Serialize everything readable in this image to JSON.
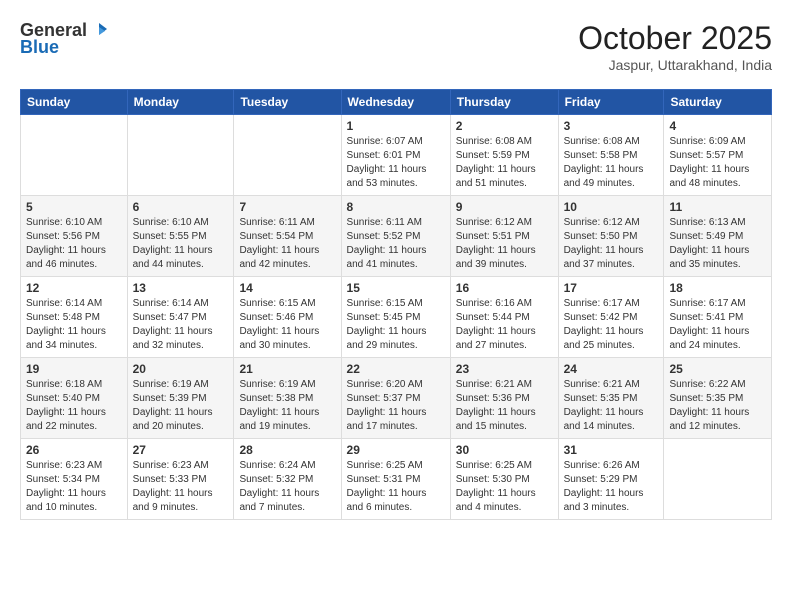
{
  "header": {
    "logo_general": "General",
    "logo_blue": "Blue",
    "month_title": "October 2025",
    "location": "Jaspur, Uttarakhand, India"
  },
  "days_of_week": [
    "Sunday",
    "Monday",
    "Tuesday",
    "Wednesday",
    "Thursday",
    "Friday",
    "Saturday"
  ],
  "weeks": [
    [
      {
        "day": "",
        "info": ""
      },
      {
        "day": "",
        "info": ""
      },
      {
        "day": "",
        "info": ""
      },
      {
        "day": "1",
        "info": "Sunrise: 6:07 AM\nSunset: 6:01 PM\nDaylight: 11 hours and 53 minutes."
      },
      {
        "day": "2",
        "info": "Sunrise: 6:08 AM\nSunset: 5:59 PM\nDaylight: 11 hours and 51 minutes."
      },
      {
        "day": "3",
        "info": "Sunrise: 6:08 AM\nSunset: 5:58 PM\nDaylight: 11 hours and 49 minutes."
      },
      {
        "day": "4",
        "info": "Sunrise: 6:09 AM\nSunset: 5:57 PM\nDaylight: 11 hours and 48 minutes."
      }
    ],
    [
      {
        "day": "5",
        "info": "Sunrise: 6:10 AM\nSunset: 5:56 PM\nDaylight: 11 hours and 46 minutes."
      },
      {
        "day": "6",
        "info": "Sunrise: 6:10 AM\nSunset: 5:55 PM\nDaylight: 11 hours and 44 minutes."
      },
      {
        "day": "7",
        "info": "Sunrise: 6:11 AM\nSunset: 5:54 PM\nDaylight: 11 hours and 42 minutes."
      },
      {
        "day": "8",
        "info": "Sunrise: 6:11 AM\nSunset: 5:52 PM\nDaylight: 11 hours and 41 minutes."
      },
      {
        "day": "9",
        "info": "Sunrise: 6:12 AM\nSunset: 5:51 PM\nDaylight: 11 hours and 39 minutes."
      },
      {
        "day": "10",
        "info": "Sunrise: 6:12 AM\nSunset: 5:50 PM\nDaylight: 11 hours and 37 minutes."
      },
      {
        "day": "11",
        "info": "Sunrise: 6:13 AM\nSunset: 5:49 PM\nDaylight: 11 hours and 35 minutes."
      }
    ],
    [
      {
        "day": "12",
        "info": "Sunrise: 6:14 AM\nSunset: 5:48 PM\nDaylight: 11 hours and 34 minutes."
      },
      {
        "day": "13",
        "info": "Sunrise: 6:14 AM\nSunset: 5:47 PM\nDaylight: 11 hours and 32 minutes."
      },
      {
        "day": "14",
        "info": "Sunrise: 6:15 AM\nSunset: 5:46 PM\nDaylight: 11 hours and 30 minutes."
      },
      {
        "day": "15",
        "info": "Sunrise: 6:15 AM\nSunset: 5:45 PM\nDaylight: 11 hours and 29 minutes."
      },
      {
        "day": "16",
        "info": "Sunrise: 6:16 AM\nSunset: 5:44 PM\nDaylight: 11 hours and 27 minutes."
      },
      {
        "day": "17",
        "info": "Sunrise: 6:17 AM\nSunset: 5:42 PM\nDaylight: 11 hours and 25 minutes."
      },
      {
        "day": "18",
        "info": "Sunrise: 6:17 AM\nSunset: 5:41 PM\nDaylight: 11 hours and 24 minutes."
      }
    ],
    [
      {
        "day": "19",
        "info": "Sunrise: 6:18 AM\nSunset: 5:40 PM\nDaylight: 11 hours and 22 minutes."
      },
      {
        "day": "20",
        "info": "Sunrise: 6:19 AM\nSunset: 5:39 PM\nDaylight: 11 hours and 20 minutes."
      },
      {
        "day": "21",
        "info": "Sunrise: 6:19 AM\nSunset: 5:38 PM\nDaylight: 11 hours and 19 minutes."
      },
      {
        "day": "22",
        "info": "Sunrise: 6:20 AM\nSunset: 5:37 PM\nDaylight: 11 hours and 17 minutes."
      },
      {
        "day": "23",
        "info": "Sunrise: 6:21 AM\nSunset: 5:36 PM\nDaylight: 11 hours and 15 minutes."
      },
      {
        "day": "24",
        "info": "Sunrise: 6:21 AM\nSunset: 5:35 PM\nDaylight: 11 hours and 14 minutes."
      },
      {
        "day": "25",
        "info": "Sunrise: 6:22 AM\nSunset: 5:35 PM\nDaylight: 11 hours and 12 minutes."
      }
    ],
    [
      {
        "day": "26",
        "info": "Sunrise: 6:23 AM\nSunset: 5:34 PM\nDaylight: 11 hours and 10 minutes."
      },
      {
        "day": "27",
        "info": "Sunrise: 6:23 AM\nSunset: 5:33 PM\nDaylight: 11 hours and 9 minutes."
      },
      {
        "day": "28",
        "info": "Sunrise: 6:24 AM\nSunset: 5:32 PM\nDaylight: 11 hours and 7 minutes."
      },
      {
        "day": "29",
        "info": "Sunrise: 6:25 AM\nSunset: 5:31 PM\nDaylight: 11 hours and 6 minutes."
      },
      {
        "day": "30",
        "info": "Sunrise: 6:25 AM\nSunset: 5:30 PM\nDaylight: 11 hours and 4 minutes."
      },
      {
        "day": "31",
        "info": "Sunrise: 6:26 AM\nSunset: 5:29 PM\nDaylight: 11 hours and 3 minutes."
      },
      {
        "day": "",
        "info": ""
      }
    ]
  ]
}
